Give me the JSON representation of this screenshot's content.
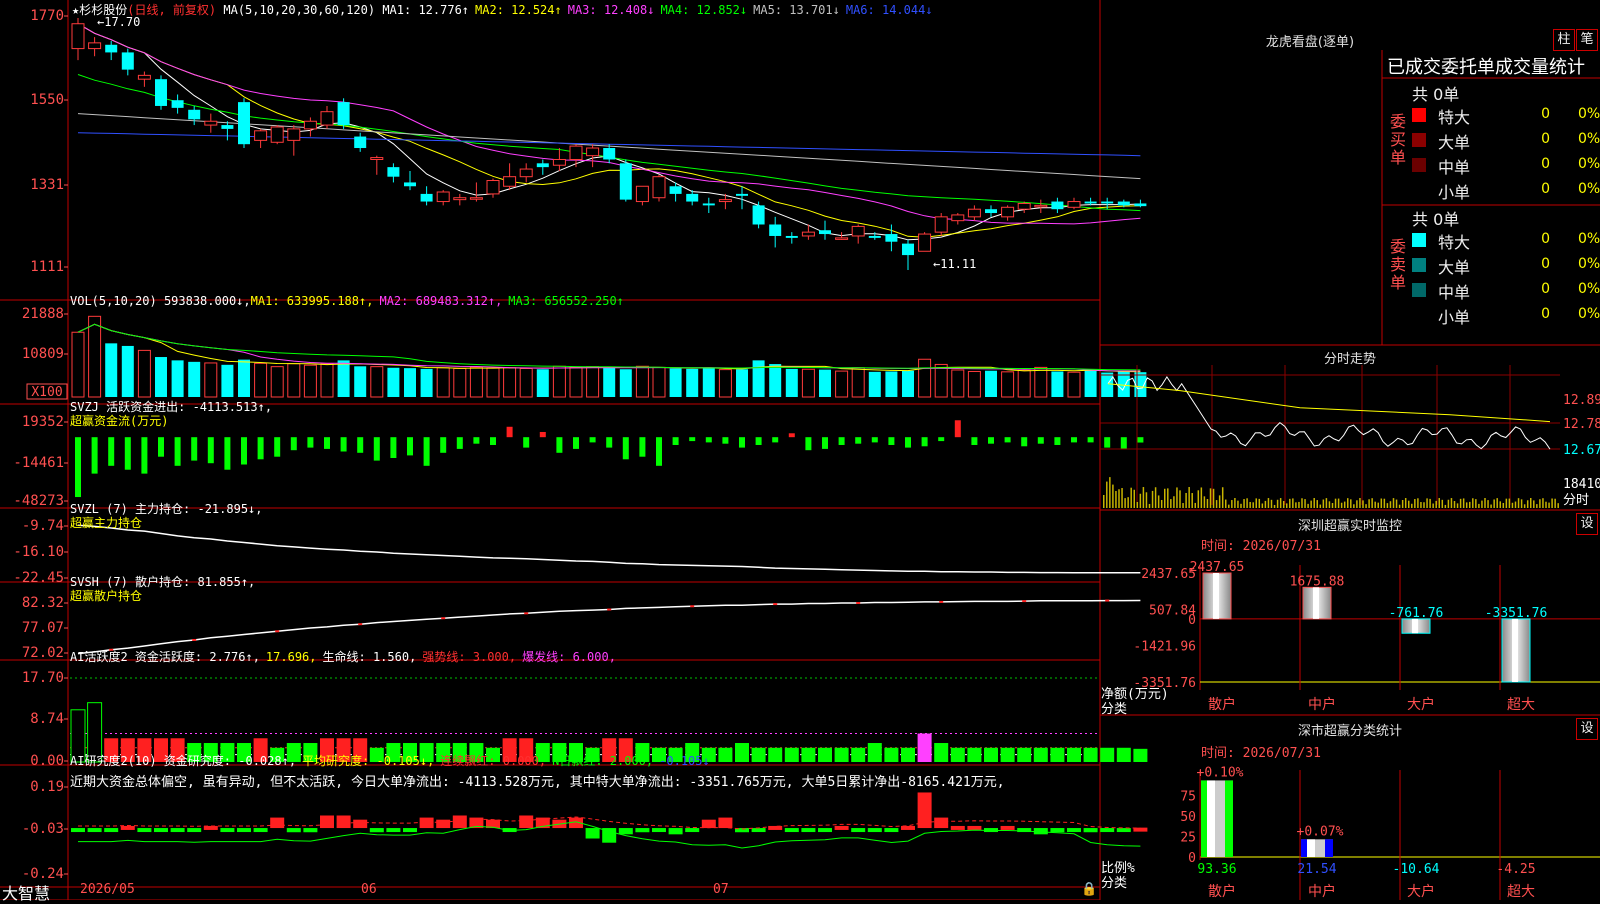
{
  "stock": {
    "name": "★杉杉股份",
    "period": "(日线, 前复权)",
    "ma_label": "MA(5,10,20,30,60,120)",
    "ma": [
      {
        "label": "MA1:",
        "value": "12.776↑",
        "color": "#ffffff"
      },
      {
        "label": "MA2:",
        "value": "12.524↑",
        "color": "#ffff00"
      },
      {
        "label": "MA3:",
        "value": "12.408↓",
        "color": "#ff40ff"
      },
      {
        "label": "MA4:",
        "value": "12.852↓",
        "color": "#00ff00"
      },
      {
        "label": "MA5:",
        "value": "13.701↓",
        "color": "#c0c0c0"
      },
      {
        "label": "MA6:",
        "value": "14.044↓",
        "color": "#3050ff"
      }
    ],
    "high_label": "17.70",
    "low_label": "11.11"
  },
  "price_axis": [
    "1770",
    "1550",
    "1331",
    "1111"
  ],
  "volume": {
    "header_name": "VOL(5,10,20)",
    "header_val": "593838.000↓,",
    "ma": [
      {
        "label": "MA1:",
        "value": "633995.188↑,",
        "color": "#ffff00"
      },
      {
        "label": "MA2:",
        "value": "689483.312↑,",
        "color": "#ff40ff"
      },
      {
        "label": "MA3:",
        "value": "656552.250↑",
        "color": "#00ff00"
      }
    ],
    "axis": [
      "21888",
      "10809"
    ],
    "unit": "X100"
  },
  "svzj": {
    "header": "SVZJ  活跃资金进出: -4113.513↑,",
    "subtitle": "超赢资金流(万元)",
    "axis": [
      "19352",
      "-14461",
      "-48273"
    ]
  },
  "svzl": {
    "header": "SVZL (7) 主力持仓: -21.895↓,",
    "subtitle": "超赢主力持仓",
    "axis": [
      "-9.74",
      "-16.10",
      "-22.45"
    ]
  },
  "svsh": {
    "header": "SVSH (7) 散户持仓: 81.855↑,",
    "subtitle": "超赢散户持仓",
    "axis": [
      "82.32",
      "77.07",
      "72.02"
    ]
  },
  "ai_active": {
    "items": [
      {
        "text": "AI活跃度2 资金活跃度: 2.776↑,",
        "color": "#ffffff"
      },
      {
        "text": "17.696,",
        "color": "#ffff00"
      },
      {
        "text": "生命线: 1.560,",
        "color": "#ffffff"
      },
      {
        "text": "强势线: 3.000,",
        "color": "#ff3030"
      },
      {
        "text": "爆发线: 6.000,",
        "color": "#ff40ff"
      }
    ],
    "axis": [
      "17.70",
      "8.74",
      "0.00"
    ]
  },
  "ai_research": {
    "items": [
      {
        "text": "AI研究度2(10) 资金研究度: -0.028↑,",
        "color": "#ffffff"
      },
      {
        "text": "平均研究度: -0.105↓,",
        "color": "#ffff00"
      },
      {
        "text": "连续飘红: 0.000,",
        "color": "#ff3030"
      },
      {
        "text": "N日飘红: 2.000,",
        "color": "#00ff00"
      },
      {
        "text": "-0.105↓",
        "color": "#3050ff"
      }
    ],
    "comment": "近期大资金总体偏空, 虽有异动, 但不太活跃, 今日大单净流出: -4113.528万元, 其中特大单净流出: -3351.765万元, 大单5日累计净出-8165.421万元,",
    "axis": [
      "0.19",
      "-0.03",
      "-0.24"
    ]
  },
  "bottom_bar": {
    "brand": "大智慧",
    "dates": [
      "2026/05",
      "06",
      "07"
    ]
  },
  "right_panel": {
    "lhb_title": "龙虎看盘(逐单)",
    "btn_zhu": "柱",
    "btn_bi": "笔",
    "tabs_text": "已成交委托单成交量统计",
    "buy_label": "委买单",
    "sell_label": "委卖单",
    "buy_total": "共 0单",
    "sell_total": "共 0单",
    "buy_rows": [
      {
        "name": "特大",
        "count": "0",
        "pct": "0%",
        "color": "#ff0000"
      },
      {
        "name": "大单",
        "count": "0",
        "pct": "0%",
        "color": "#8b0000"
      },
      {
        "name": "中单",
        "count": "0",
        "pct": "0%",
        "color": "#6b0000"
      },
      {
        "name": "小单",
        "count": "0",
        "pct": "0%",
        "color": ""
      }
    ],
    "sell_rows": [
      {
        "name": "特大",
        "count": "0",
        "pct": "0%",
        "color": "#00ffff"
      },
      {
        "name": "大单",
        "count": "0",
        "pct": "0%",
        "color": "#008080"
      },
      {
        "name": "中单",
        "count": "0",
        "pct": "0%",
        "color": "#006868"
      },
      {
        "name": "小单",
        "count": "0",
        "pct": "0%",
        "color": ""
      }
    ],
    "intraday_title": "分时走势",
    "intraday_axis": [
      "12.89",
      "12.78",
      "12.67"
    ],
    "intraday_vol": "18410",
    "intraday_unit": "分时",
    "sz_monitor": {
      "title": "深圳超赢实时监控",
      "time": "时间: 2026/07/31",
      "btn": "设",
      "axis": [
        "2437.65",
        "507.84",
        "0",
        "-1421.96",
        "-3351.76"
      ],
      "ylabel": "净额(万元)",
      "xlabel": "分类"
    },
    "sz_class": {
      "title": "深市超赢分类统计",
      "time": "时间: 2026/07/31",
      "btn": "设",
      "axis": [
        "75",
        "50",
        "25",
        "0"
      ],
      "ylabel": "比例%",
      "xlabel": "分类",
      "top_labels": [
        "+0.10%",
        "+0.07%"
      ]
    }
  },
  "chart_data": [
    {
      "type": "candlestick",
      "title": "杉杉股份 (日线, 前复权)",
      "ylim": [
        11.11,
        17.7
      ],
      "ohlc": [
        [
          16.9,
          17.7,
          16.6,
          17.55
        ],
        [
          16.9,
          17.2,
          16.7,
          17.05
        ],
        [
          17.0,
          17.1,
          16.6,
          16.8
        ],
        [
          16.8,
          16.9,
          16.2,
          16.35
        ],
        [
          16.1,
          16.3,
          15.9,
          16.2
        ],
        [
          16.1,
          16.2,
          15.3,
          15.4
        ],
        [
          15.55,
          15.7,
          15.2,
          15.35
        ],
        [
          15.3,
          15.4,
          14.9,
          15.05
        ],
        [
          14.9,
          15.2,
          14.7,
          15.0
        ],
        [
          14.9,
          15.0,
          14.5,
          14.8
        ],
        [
          15.5,
          15.6,
          14.3,
          14.4
        ],
        [
          14.5,
          14.8,
          14.3,
          14.75
        ],
        [
          14.45,
          14.9,
          14.4,
          14.85
        ],
        [
          14.5,
          14.9,
          14.1,
          14.8
        ],
        [
          14.8,
          15.1,
          14.6,
          15.0
        ],
        [
          14.9,
          15.4,
          14.8,
          15.25
        ],
        [
          15.5,
          15.6,
          14.8,
          14.9
        ],
        [
          14.6,
          14.7,
          14.2,
          14.3
        ],
        [
          14.0,
          14.1,
          13.6,
          14.05
        ],
        [
          13.8,
          13.9,
          13.4,
          13.55
        ],
        [
          13.4,
          13.7,
          13.2,
          13.3
        ],
        [
          13.1,
          13.3,
          12.8,
          12.9
        ],
        [
          12.9,
          13.2,
          12.8,
          13.15
        ],
        [
          12.95,
          13.1,
          12.8,
          13.0
        ],
        [
          13.0,
          13.4,
          12.9,
          13.0
        ],
        [
          13.1,
          13.5,
          13.0,
          13.45
        ],
        [
          13.3,
          13.9,
          13.2,
          13.55
        ],
        [
          13.55,
          13.9,
          13.4,
          13.75
        ],
        [
          13.9,
          14.0,
          13.6,
          13.8
        ],
        [
          13.85,
          14.3,
          13.7,
          14.0
        ],
        [
          14.0,
          14.4,
          13.8,
          14.35
        ],
        [
          14.1,
          14.4,
          13.8,
          14.3
        ],
        [
          14.3,
          14.4,
          13.9,
          14.0
        ],
        [
          13.9,
          14.0,
          12.9,
          12.95
        ],
        [
          12.9,
          13.3,
          12.8,
          13.3
        ],
        [
          13.0,
          13.6,
          12.9,
          13.55
        ],
        [
          13.3,
          13.4,
          12.9,
          13.1
        ],
        [
          13.1,
          13.2,
          12.8,
          12.9
        ],
        [
          12.85,
          13.0,
          12.6,
          12.8
        ],
        [
          12.9,
          13.1,
          12.7,
          12.95
        ],
        [
          13.1,
          13.3,
          12.7,
          13.05
        ],
        [
          12.8,
          12.9,
          12.2,
          12.3
        ],
        [
          12.3,
          12.5,
          11.7,
          12.0
        ],
        [
          12.0,
          12.1,
          11.8,
          11.95
        ],
        [
          12.0,
          12.3,
          11.9,
          12.1
        ],
        [
          12.15,
          12.4,
          11.9,
          12.05
        ],
        [
          11.95,
          12.1,
          11.9,
          11.95
        ],
        [
          12.0,
          12.3,
          11.8,
          12.25
        ],
        [
          12.0,
          12.1,
          11.9,
          11.95
        ],
        [
          12.05,
          12.3,
          11.6,
          11.85
        ],
        [
          11.8,
          11.9,
          11.11,
          11.5
        ],
        [
          11.6,
          12.1,
          11.6,
          12.05
        ],
        [
          12.1,
          12.6,
          12.0,
          12.5
        ],
        [
          12.4,
          12.6,
          12.3,
          12.55
        ],
        [
          12.5,
          12.8,
          12.4,
          12.7
        ],
        [
          12.7,
          12.8,
          12.5,
          12.6
        ],
        [
          12.5,
          12.8,
          12.4,
          12.75
        ],
        [
          12.7,
          12.9,
          12.6,
          12.85
        ],
        [
          12.8,
          12.95,
          12.6,
          12.8
        ],
        [
          12.9,
          13.0,
          12.6,
          12.7
        ],
        [
          12.75,
          13.0,
          12.7,
          12.9
        ],
        [
          12.9,
          13.0,
          12.8,
          12.85
        ],
        [
          12.9,
          13.0,
          12.7,
          12.85
        ],
        [
          12.9,
          12.95,
          12.75,
          12.8
        ],
        [
          12.85,
          12.95,
          12.75,
          12.78
        ]
      ]
    },
    {
      "type": "bar",
      "title": "VOL(5,10,20)",
      "unit": "X100",
      "ylim": [
        0,
        21888
      ],
      "values": [
        17500,
        21800,
        14500,
        13800,
        12600,
        10800,
        9900,
        9500,
        9200,
        8700,
        10100,
        9100,
        8200,
        9000,
        8600,
        8900,
        9900,
        8300,
        8200,
        7900,
        7800,
        7600,
        7900,
        7700,
        8100,
        7800,
        7900,
        7700,
        7500,
        8300,
        8100,
        8200,
        8000,
        7500,
        8300,
        8000,
        7700,
        7600,
        7800,
        7400,
        7500,
        9900,
        8900,
        7600,
        7500,
        7400,
        7000,
        7900,
        6800,
        6900,
        7100,
        10200,
        8800,
        7300,
        6900,
        7100,
        6800,
        7200,
        8000,
        6900,
        6700,
        7300,
        6600,
        6900,
        6700
      ]
    },
    {
      "type": "bar",
      "title": "SVZJ 活跃资金进出",
      "ylim": [
        -48273,
        19352
      ],
      "values": [
        -46000,
        -28000,
        -22000,
        -25000,
        -28000,
        -15000,
        -22000,
        -18000,
        -20000,
        -25000,
        -21000,
        -17000,
        -15000,
        -10000,
        -8000,
        -9000,
        -11000,
        -12000,
        -18000,
        -16000,
        -14000,
        -22000,
        -12000,
        -9000,
        -5000,
        -6000,
        8000,
        -8000,
        4000,
        -12000,
        -9000,
        -4000,
        -8000,
        -17000,
        -15000,
        -22000,
        -6000,
        -3000,
        -4000,
        -5000,
        -8000,
        -6000,
        -4000,
        3000,
        -10000,
        -9000,
        -6000,
        -5000,
        -4000,
        -6000,
        -8000,
        -7000,
        -3000,
        13000,
        -6000,
        -5000,
        -4000,
        -7000,
        -5000,
        -6000,
        -4000,
        -4000,
        -8000,
        -9000,
        -4113
      ]
    },
    {
      "type": "line",
      "title": "SVZL (7) 主力持仓",
      "ylim": [
        -22.45,
        -9.74
      ],
      "values": [
        -9.8,
        -10.1,
        -10.5,
        -11.0,
        -11.3,
        -11.9,
        -12.5,
        -13.0,
        -13.3,
        -13.8,
        -14.2,
        -14.6,
        -15.0,
        -15.3,
        -15.6,
        -15.9,
        -16.1,
        -16.4,
        -16.6,
        -16.9,
        -17.1,
        -17.3,
        -17.5,
        -17.7,
        -17.9,
        -18.1,
        -18.2,
        -18.3,
        -18.5,
        -18.7,
        -18.9,
        -19.0,
        -19.2,
        -19.5,
        -19.6,
        -19.8,
        -19.9,
        -20.0,
        -20.1,
        -20.2,
        -20.3,
        -20.5,
        -20.7,
        -20.8,
        -20.9,
        -21.0,
        -21.1,
        -21.2,
        -21.3,
        -21.4,
        -21.5,
        -21.5,
        -21.6,
        -21.6,
        -21.7,
        -21.7,
        -21.8,
        -21.8,
        -21.85,
        -21.85,
        -21.88,
        -21.9,
        -21.9,
        -21.9,
        -21.895
      ]
    },
    {
      "type": "line",
      "title": "SVSH (7) 散户持仓",
      "ylim": [
        72.02,
        82.32
      ],
      "values": [
        72.1,
        72.4,
        72.8,
        73.1,
        73.5,
        73.9,
        74.3,
        74.6,
        75.0,
        75.3,
        75.6,
        75.9,
        76.2,
        76.5,
        76.8,
        77.0,
        77.3,
        77.5,
        77.8,
        78.0,
        78.2,
        78.4,
        78.6,
        78.8,
        79.0,
        79.2,
        79.4,
        79.5,
        79.7,
        79.9,
        80.0,
        80.1,
        80.2,
        80.4,
        80.5,
        80.6,
        80.7,
        80.8,
        80.9,
        81.0,
        81.0,
        81.1,
        81.2,
        81.2,
        81.3,
        81.3,
        81.4,
        81.4,
        81.5,
        81.5,
        81.55,
        81.6,
        81.6,
        81.65,
        81.7,
        81.7,
        81.7,
        81.75,
        81.8,
        81.8,
        81.8,
        81.8,
        81.85,
        81.85,
        81.855
      ]
    },
    {
      "type": "bar",
      "title": "AI活跃度2 资金活跃度",
      "ylim": [
        0,
        17.7
      ],
      "values": [
        11,
        12.5,
        5,
        5,
        5,
        5,
        5,
        4,
        4,
        4,
        4,
        5,
        3,
        4,
        4,
        5,
        5,
        5,
        3,
        4,
        4,
        4,
        4,
        4,
        4,
        3,
        5,
        5,
        4,
        4,
        4,
        3,
        5,
        5,
        4,
        3,
        3,
        4,
        3,
        3,
        4,
        3,
        3,
        3,
        3,
        3,
        3,
        3,
        4,
        3,
        3,
        6,
        4,
        3,
        3,
        3,
        3,
        3,
        3,
        3,
        3,
        3,
        3,
        3,
        2.776
      ]
    },
    {
      "type": "bar",
      "title": "AI研究度2(10) 资金研究度",
      "ylim": [
        -0.24,
        0.19
      ],
      "values": [
        -0.03,
        -0.03,
        -0.03,
        -0.02,
        -0.04,
        -0.03,
        -0.03,
        -0.04,
        -0.02,
        -0.03,
        -0.03,
        -0.03,
        0.02,
        -0.05,
        -0.05,
        0.03,
        0.03,
        0.01,
        -0.05,
        -0.04,
        -0.03,
        0.02,
        0.01,
        0.03,
        0.02,
        0.01,
        -0.04,
        0.03,
        0.02,
        0.01,
        0.02,
        -0.08,
        -0.1,
        -0.06,
        -0.05,
        -0.04,
        -0.06,
        -0.03,
        0.01,
        0.02,
        -0.05,
        -0.03,
        -0.02,
        -0.03,
        -0.04,
        -0.03,
        -0.02,
        -0.03,
        -0.04,
        -0.03,
        -0.02,
        0.14,
        0.02,
        -0.02,
        -0.02,
        -0.04,
        -0.02,
        -0.04,
        -0.06,
        -0.05,
        -0.04,
        -0.05,
        -0.03,
        -0.04,
        -0.028
      ]
    },
    {
      "type": "bar",
      "title": "深圳超赢实时监控",
      "xlabel": "分类",
      "ylabel": "净额(万元)",
      "categories": [
        "散户",
        "中户",
        "大户",
        "超大"
      ],
      "values": [
        2437.65,
        1675.88,
        -761.76,
        -3351.76
      ],
      "value_labels": [
        "2437.65",
        "1675.88",
        "-761.76",
        "-3351.76"
      ],
      "ylim": [
        -3351.76,
        2437.65
      ]
    },
    {
      "type": "bar",
      "title": "深市超赢分类统计",
      "xlabel": "分类",
      "ylabel": "比例%",
      "categories": [
        "散户",
        "中户",
        "大户",
        "超大"
      ],
      "values": [
        93.36,
        21.54,
        -10.64,
        -4.25
      ],
      "value_labels": [
        "93.36",
        "21.54",
        "-10.64",
        "-4.25"
      ],
      "ylim": [
        0,
        100
      ]
    }
  ]
}
